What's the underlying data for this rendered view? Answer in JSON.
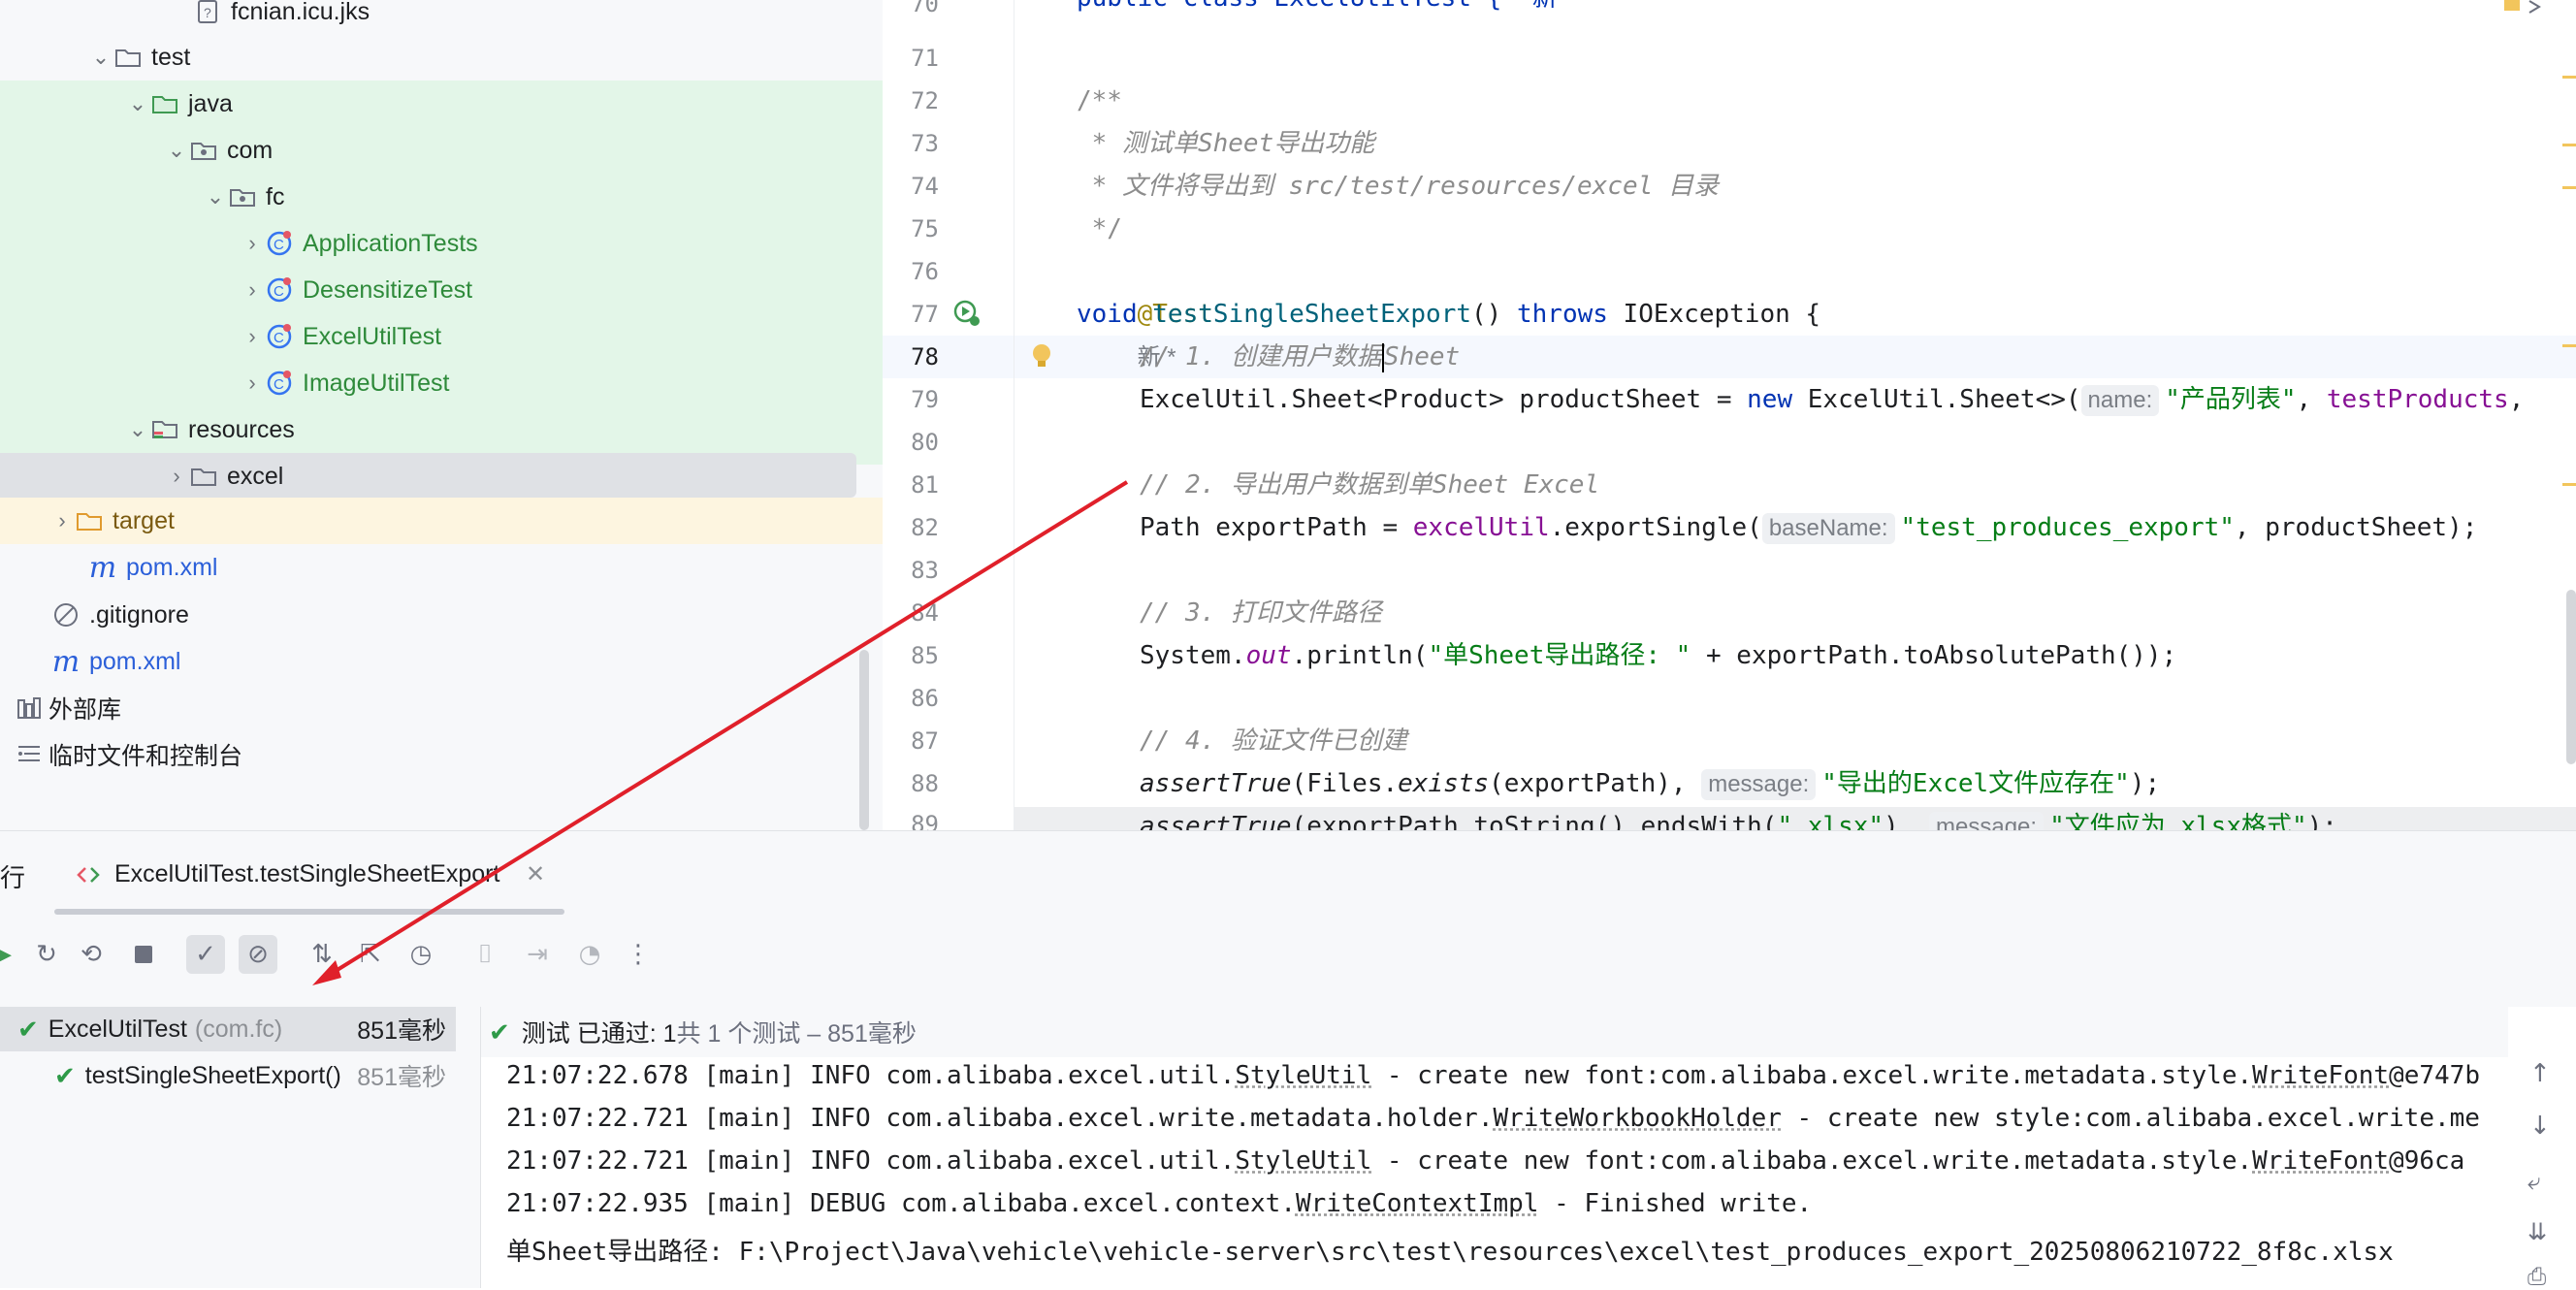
{
  "tree": {
    "items": [
      {
        "label": "fcnian.icu.jks",
        "icon": "unknown-file-icon"
      },
      {
        "label": "test",
        "icon": "folder-icon"
      },
      {
        "label": "java",
        "icon": "test-source-folder-icon"
      },
      {
        "label": "com",
        "icon": "package-icon"
      },
      {
        "label": "fc",
        "icon": "package-icon"
      },
      {
        "label": "ApplicationTests",
        "icon": "test-class-icon"
      },
      {
        "label": "DesensitizeTest",
        "icon": "test-class-icon"
      },
      {
        "label": "ExcelUtilTest",
        "icon": "test-class-icon"
      },
      {
        "label": "ImageUtilTest",
        "icon": "test-class-icon"
      },
      {
        "label": "resources",
        "icon": "test-resources-folder-icon"
      },
      {
        "label": "excel",
        "icon": "folder-icon"
      },
      {
        "label": "target",
        "icon": "folder-icon"
      },
      {
        "label": "pom.xml",
        "icon": "maven-icon"
      },
      {
        "label": ".gitignore",
        "icon": "ignored-file-icon"
      },
      {
        "label": "pom.xml",
        "icon": "maven-icon"
      },
      {
        "label": "外部库",
        "icon": "library-icon"
      },
      {
        "label": "临时文件和控制台",
        "icon": "scratches-icon"
      }
    ]
  },
  "editor": {
    "top_partial": "public class ExcelUtilTest {  新",
    "lines": [
      {
        "n": "70"
      },
      {
        "n": "71"
      },
      {
        "n": "72"
      },
      {
        "n": "73"
      },
      {
        "n": "74"
      },
      {
        "n": "75"
      },
      {
        "n": "76"
      },
      {
        "n": "77"
      },
      {
        "n": "78"
      },
      {
        "n": "79"
      },
      {
        "n": "80"
      },
      {
        "n": "81"
      },
      {
        "n": "82"
      },
      {
        "n": "83"
      },
      {
        "n": "84"
      },
      {
        "n": "85"
      },
      {
        "n": "86"
      },
      {
        "n": "87"
      },
      {
        "n": "88"
      },
      {
        "n": "89"
      }
    ],
    "code": {
      "l72": "/**",
      "l73": " * 测试单Sheet导出功能",
      "l74": " * 文件将导出到 src/test/resources/excel 目录",
      "l75": " */",
      "l76_ann": "@Test",
      "l76_hint": "新 *",
      "l77_void": "void ",
      "l77_name": "testSingleSheetExport",
      "l77_paren": "() ",
      "l77_throws": "throws",
      "l77_rest": " IOException {",
      "l78_a": "// 1. 创建用户数据",
      "l78_b": "Sheet",
      "l79_a": "ExcelUtil.Sheet<Product> productSheet = ",
      "l79_new": "new",
      "l79_b": " ExcelUtil.Sheet<>(",
      "l79_hint": "name:",
      "l79_str": "\"产品列表\"",
      "l79_c": ", ",
      "l79_fld": "testProducts",
      "l79_d": ",",
      "l81": "// 2. 导出用户数据到单Sheet Excel",
      "l82_a": "Path exportPath = ",
      "l82_fld": "excelUtil",
      "l82_b": ".exportSingle(",
      "l82_hint": "baseName:",
      "l82_str": "\"test_produces_export\"",
      "l82_c": ", productSheet);",
      "l84": "// 3. 打印文件路径",
      "l85_a": "System.",
      "l85_out": "out",
      "l85_b": ".println(",
      "l85_str": "\"单Sheet导出路径: \"",
      "l85_c": " + exportPath.toAbsolutePath());",
      "l87": "// 4. 验证文件已创建",
      "l88_a": "assertTrue",
      "l88_b": "(Files.",
      "l88_c": "exists",
      "l88_d": "(exportPath),",
      "l88_hint": "message:",
      "l88_str": "\"导出的Excel文件应存在\"",
      "l88_e": ");",
      "l89_a": "assertTrue",
      "l89_b": "(exportPath.toString().endsWith(",
      "l89_str": "\".xlsx\"",
      "l89_c": "),",
      "l89_hint": "message:",
      "l89_str2": "\"文件应为.xlsx格式\"",
      "l89_d": ");"
    }
  },
  "run": {
    "panel_label": "行",
    "tab_label": "ExcelUtilTest.testSingleSheetExport",
    "results": [
      {
        "name": "ExcelUtilTest",
        "pkg": "(com.fc)",
        "time": "851毫秒"
      },
      {
        "name": "testSingleSheetExport()",
        "pkg": "",
        "time": "851毫秒"
      }
    ],
    "status_passed": "测试 已通过: 1",
    "status_summary": "共 1 个测试 – 851毫秒",
    "log": [
      {
        "a": "21:07:22.678 [main] INFO com.alibaba.excel.util.",
        "u": "StyleUtil",
        "b": " - create new font:com.alibaba.excel.write.metadata.style.",
        "u2": "WriteFont",
        "c": "@e747b"
      },
      {
        "a": "21:07:22.721 [main] INFO com.alibaba.excel.write.metadata.holder.",
        "u": "WriteWorkbookHolder",
        "b": " - create new style:com.alibaba.excel.write.me",
        "u2": "",
        "c": ""
      },
      {
        "a": "21:07:22.721 [main] INFO com.alibaba.excel.util.",
        "u": "StyleUtil",
        "b": " - create new font:com.alibaba.excel.write.metadata.style.",
        "u2": "WriteFont",
        "c": "@96ca"
      },
      {
        "a": "21:07:22.935 [main] DEBUG com.alibaba.excel.context.",
        "u": "WriteContextImpl",
        "b": " - Finished write.",
        "u2": "",
        "c": ""
      },
      {
        "a": "单Sheet导出路径: F:\\Project\\Java\\vehicle\\vehicle-server\\src\\test\\resources\\excel\\test_produces_export_20250806210722_8f8c.xlsx",
        "u": "",
        "b": "",
        "u2": "",
        "c": ""
      }
    ]
  },
  "colors": {
    "arrow": "#e0202a",
    "pass": "#2e9a48",
    "accent": "#3574f0"
  }
}
